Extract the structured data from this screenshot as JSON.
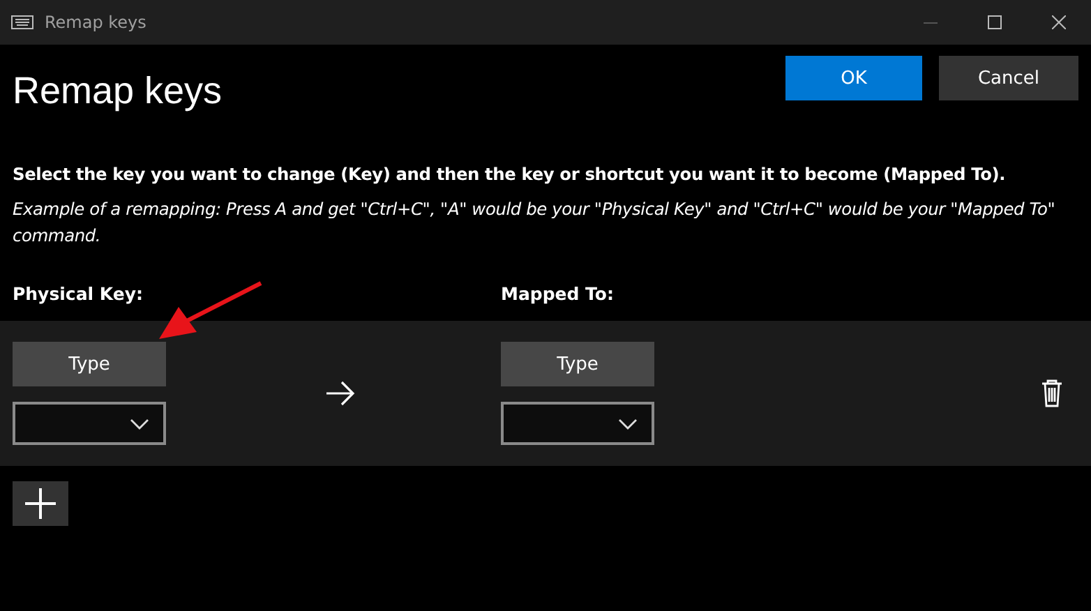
{
  "window": {
    "title": "Remap keys"
  },
  "header": {
    "title": "Remap keys",
    "buttons": [
      {
        "label": "OK",
        "kind": "primary"
      },
      {
        "label": "Cancel",
        "kind": "secondary"
      }
    ]
  },
  "instruction": "Select the key you want to change (Key) and then the key or shortcut you want it to become (Mapped To).",
  "example": "Example of a remapping: Press A and get \"Ctrl+C\", \"A\" would be your \"Physical Key\" and \"Ctrl+C\" would be your \"Mapped To\" command.",
  "columns": [
    "Physical Key:",
    "Mapped To:"
  ],
  "mappings": [
    {
      "physical": {
        "type_button": "Type"
      },
      "mapped": {
        "type_button": "Type"
      }
    }
  ],
  "annotation": {
    "kind": "arrow"
  }
}
